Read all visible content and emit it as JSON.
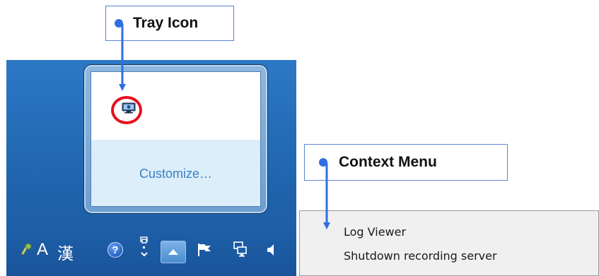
{
  "callouts": {
    "tray_icon_label": "Tray Icon",
    "context_menu_label": "Context Menu"
  },
  "tray_popup": {
    "customize_label": "Customize…"
  },
  "taskbar": {
    "lang_label": "A",
    "hanja_label": "漢",
    "help_label": "?",
    "icons": [
      "ime-pad-icon",
      "help-icon",
      "pen-icon",
      "show-hidden-icons-button",
      "flag-icon",
      "network-icon",
      "volume-icon"
    ]
  },
  "context_menu": {
    "items": [
      "Log Viewer",
      "Shutdown recording server"
    ]
  },
  "colors": {
    "callout_accent": "#2f6fe0",
    "highlight": "#e8101b",
    "customize_link": "#3b7fc2",
    "taskbar": "#1d5fa8"
  }
}
